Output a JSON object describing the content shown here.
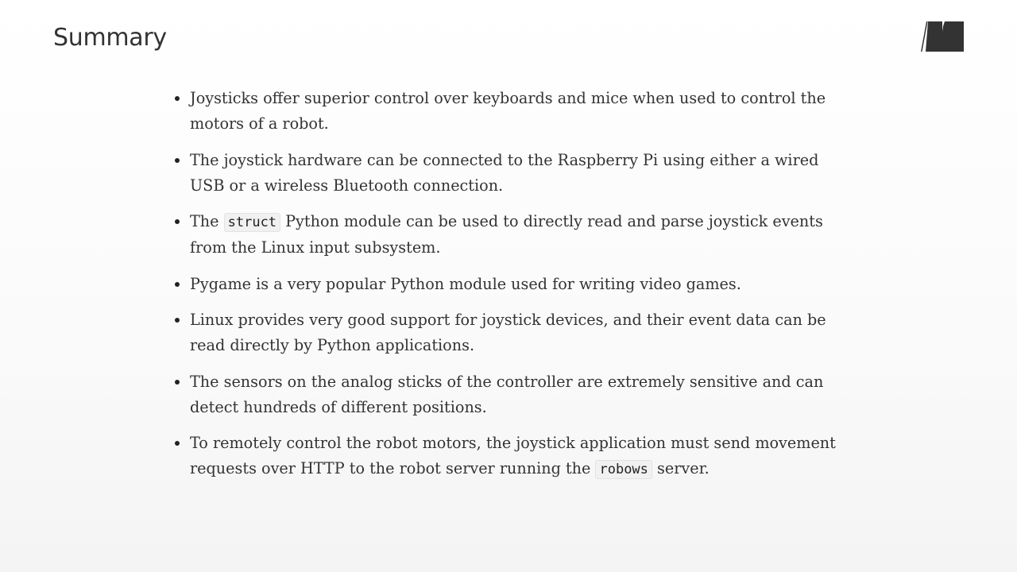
{
  "slide": {
    "title": "Summary"
  },
  "logo": {
    "icon": "publisher-logo-icon",
    "color": "#333333"
  },
  "bullets": [
    {
      "parts": [
        {
          "type": "text",
          "value": "Joysticks offer superior control over keyboards and mice when used to control the motors of a robot."
        }
      ]
    },
    {
      "parts": [
        {
          "type": "text",
          "value": "The joystick hardware can be connected to the Raspberry Pi using either a wired USB or a wireless Bluetooth connection."
        }
      ]
    },
    {
      "parts": [
        {
          "type": "text",
          "value": "The "
        },
        {
          "type": "code",
          "value": "struct"
        },
        {
          "type": "text",
          "value": " Python module can be used to directly read and parse joystick events from the Linux input subsystem."
        }
      ]
    },
    {
      "parts": [
        {
          "type": "text",
          "value": "Pygame is a very popular Python module used for writing video games."
        }
      ]
    },
    {
      "parts": [
        {
          "type": "text",
          "value": "Linux provides very good support for joystick devices, and their event data can be read directly by Python applications."
        }
      ]
    },
    {
      "parts": [
        {
          "type": "text",
          "value": "The sensors on the analog sticks of the controller are extremely sensitive and can detect hundreds of different positions."
        }
      ]
    },
    {
      "parts": [
        {
          "type": "text",
          "value": "To remotely control the robot motors, the joystick application must send movement requests over HTTP to the robot server running the "
        },
        {
          "type": "code",
          "value": "robows"
        },
        {
          "type": "text",
          "value": " server."
        }
      ]
    }
  ]
}
